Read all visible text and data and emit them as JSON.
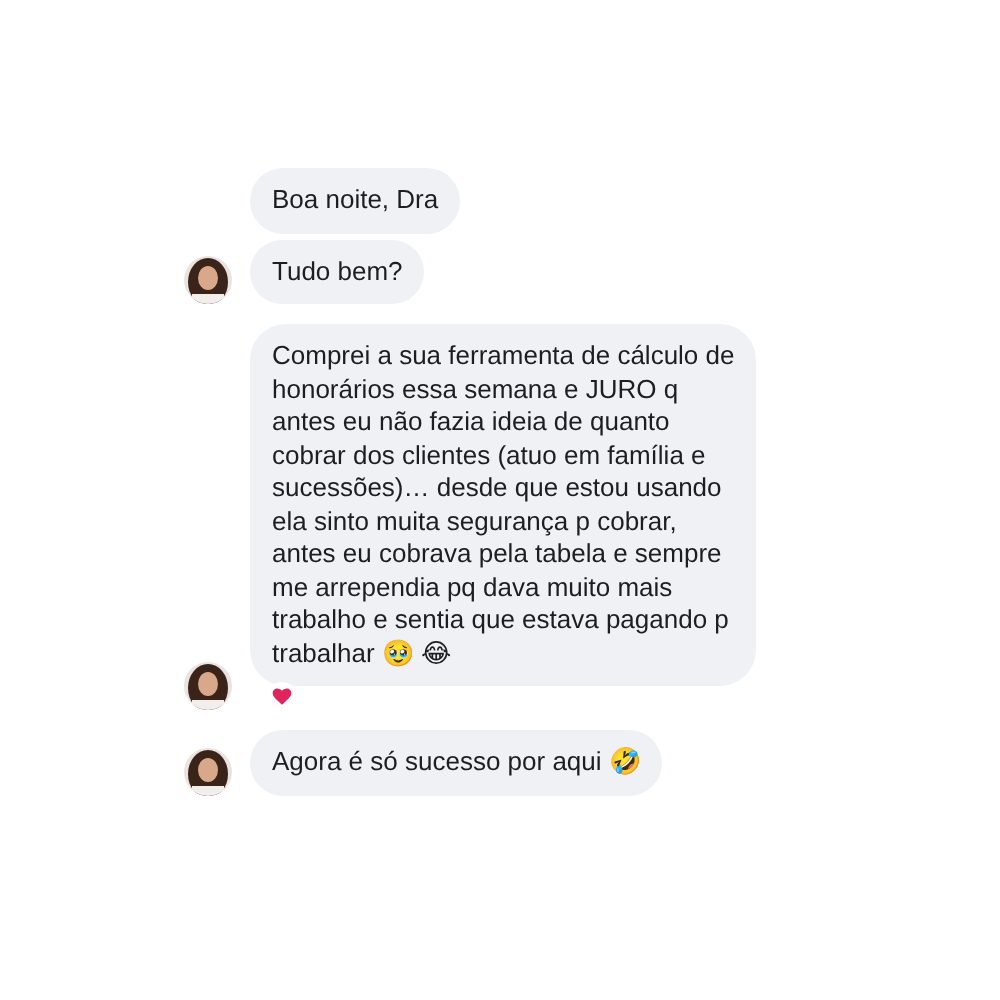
{
  "groups": [
    {
      "avatar": true,
      "messages": [
        {
          "text": "Boa noite, Dra",
          "reacted": false
        },
        {
          "text": "Tudo bem?",
          "reacted": false
        }
      ]
    },
    {
      "avatar": true,
      "messages": [
        {
          "text": "Comprei a sua ferramenta de cálculo de\nhonorários essa semana e JURO q\nantes eu não fazia ideia de quanto\ncobrar dos clientes (atuo em família e\nsucessões)… desde que estou usando\nela sinto muita segurança p cobrar,\nantes eu cobrava pela tabela e sempre\nme arrependia pq dava muito mais\ntrabalho e sentia que estava pagando p\ntrabalhar 🥹 😂",
          "reacted": true
        }
      ]
    },
    {
      "avatar": true,
      "messages": [
        {
          "text": "Agora é só sucesso por aqui 🤣",
          "reacted": false
        }
      ]
    }
  ]
}
